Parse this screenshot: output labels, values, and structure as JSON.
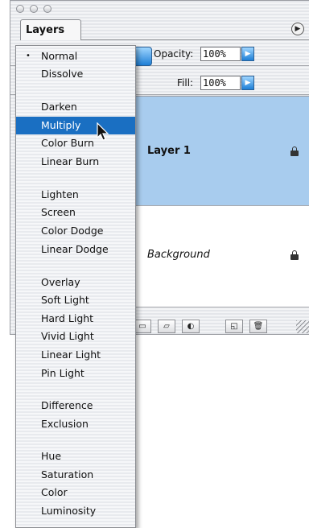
{
  "panel": {
    "tab_label": "Layers",
    "menu_icon": "triangle-right-icon",
    "opacity_label": "Opacity:",
    "opacity_value": "100%",
    "fill_label": "Fill:",
    "fill_value": "100%",
    "layers": [
      {
        "name": "Layer 1",
        "selected": true,
        "locked": true
      },
      {
        "name": "Background",
        "selected": false,
        "locked": true
      }
    ],
    "toolbar_icons": [
      "layer-style-icon",
      "mask-icon",
      "folder-icon",
      "adjustment-layer-icon",
      "new-layer-icon",
      "trash-icon"
    ]
  },
  "blend_menu": {
    "selected": "Normal",
    "highlighted": "Multiply",
    "items": [
      {
        "label": "Normal",
        "checked": true
      },
      {
        "label": "Dissolve"
      },
      {
        "label": "Darken"
      },
      {
        "label": "Multiply",
        "highlighted": true
      },
      {
        "label": "Color Burn"
      },
      {
        "label": "Linear Burn"
      },
      {
        "label": "Lighten"
      },
      {
        "label": "Screen"
      },
      {
        "label": "Color Dodge"
      },
      {
        "label": "Linear Dodge"
      },
      {
        "label": "Overlay"
      },
      {
        "label": "Soft Light"
      },
      {
        "label": "Hard Light"
      },
      {
        "label": "Vivid Light"
      },
      {
        "label": "Linear Light"
      },
      {
        "label": "Pin Light"
      },
      {
        "label": "Difference"
      },
      {
        "label": "Exclusion"
      },
      {
        "label": "Hue"
      },
      {
        "label": "Saturation"
      },
      {
        "label": "Color"
      },
      {
        "label": "Luminosity"
      }
    ],
    "check_glyph": "•"
  },
  "colors": {
    "highlight": "#1a6fc2",
    "selected_layer": "#a8ccee",
    "stepper": "#1e7fd6"
  }
}
